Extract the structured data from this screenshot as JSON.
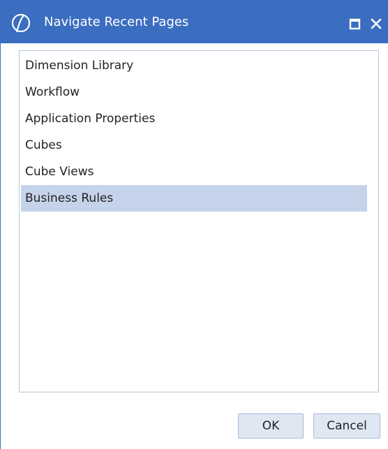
{
  "window": {
    "title": "Navigate Recent Pages",
    "accent_color": "#3b6dc0",
    "title_text_color": "#ffffff",
    "logo_icon": "onestream-logo-icon",
    "maximize_icon": "maximize-icon",
    "close_icon": "close-icon"
  },
  "recent_pages": {
    "selected_color": "#c5d3ea",
    "selected_item": "Business Rules",
    "items": [
      {
        "label": "Dimension Library"
      },
      {
        "label": "Workflow"
      },
      {
        "label": "Application Properties"
      },
      {
        "label": "Cubes"
      },
      {
        "label": "Cube Views"
      },
      {
        "label": "Business Rules"
      }
    ]
  },
  "buttons": {
    "ok_label": "OK",
    "cancel_label": "Cancel"
  }
}
